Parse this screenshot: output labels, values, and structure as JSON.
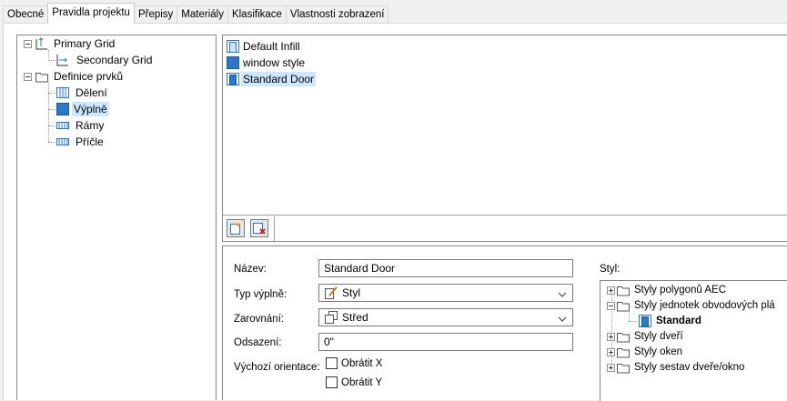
{
  "tabs": [
    "Obecné",
    "Pravidla projektu",
    "Přepisy",
    "Materiály",
    "Klasifikace",
    "Vlastnosti zobrazení"
  ],
  "tree": {
    "primary_grid": "Primary Grid",
    "secondary_grid": "Secondary Grid",
    "definice": "Definice prvků",
    "deleni": "Dělení",
    "vyplne": "Výplně",
    "ramy": "Rámy",
    "pricle": "Příčle"
  },
  "infill_list": [
    "Default Infill",
    "window style",
    "Standard Door"
  ],
  "form": {
    "nazev_label": "Název:",
    "nazev_value": "Standard Door",
    "typ_label": "Typ výplně:",
    "typ_value": "Styl",
    "zarovnani_label": "Zarovnání:",
    "zarovnani_value": "Střed",
    "odsazeni_label": "Odsazení:",
    "odsazeni_value": "0\"",
    "orientace_label": "Výchozí orientace:",
    "obratit_x": "Obrátit X",
    "obratit_y": "Obrátit Y"
  },
  "style_tree": {
    "label": "Styl:",
    "items": [
      "Styly polygonů AEC",
      "Styly jednotek obvodových plá",
      "Standard",
      "Styly dveří",
      "Styly oken",
      "Styly sestav dveře/okno"
    ]
  },
  "colors": {
    "selection": "#cce8ff",
    "icon_blue": "#2b78c9"
  }
}
